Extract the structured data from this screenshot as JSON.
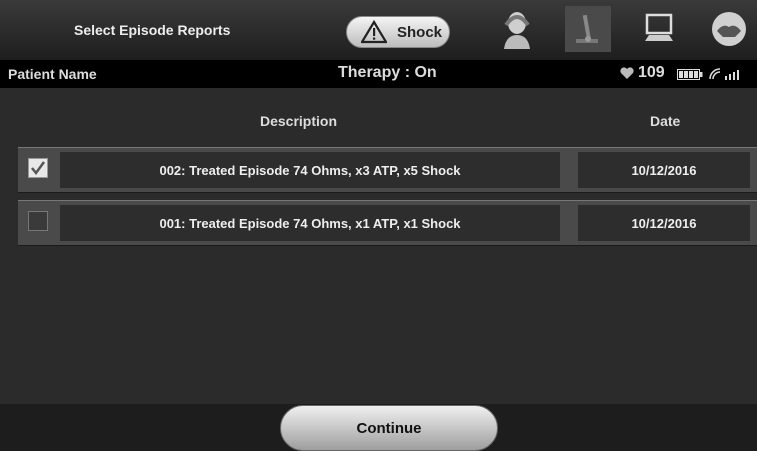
{
  "header": {
    "title": "Select Episode Reports",
    "shock_label": "Shock"
  },
  "status": {
    "patient_name_label": "Patient Name",
    "therapy": "Therapy : On",
    "heart_rate": "109"
  },
  "table": {
    "columns": [
      "Description",
      "Date"
    ],
    "rows": [
      {
        "checked": true,
        "description": "002: Treated Episode 74 Ohms, x3 ATP, x5 Shock",
        "date": "10/12/2016"
      },
      {
        "checked": false,
        "description": "001: Treated Episode 74 Ohms, x1 ATP, x1 Shock",
        "date": "10/12/2016"
      }
    ]
  },
  "footer": {
    "continue_label": "Continue"
  },
  "icons": [
    "warning-icon",
    "patient-icon",
    "programmer-wand-icon",
    "computer-icon",
    "handshake-icon",
    "heart-icon",
    "battery-icon",
    "signal-icon"
  ],
  "colors": {
    "background": "#2b2b2b",
    "row": "#4a4a4a",
    "cell": "#2d2d2d",
    "button": "#d8d8d8"
  }
}
